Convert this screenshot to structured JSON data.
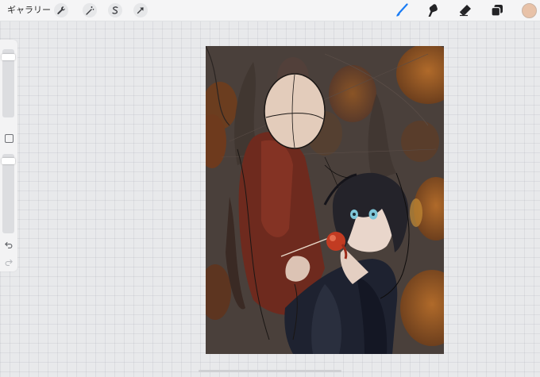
{
  "toolbar": {
    "gallery_label": "ギャラリー",
    "left_tools": [
      {
        "name": "actions",
        "icon": "wrench-icon"
      },
      {
        "name": "adjustments",
        "icon": "magic-wand-icon"
      },
      {
        "name": "selection",
        "icon": "selection-s-icon"
      },
      {
        "name": "transform",
        "icon": "arrow-cursor-icon"
      }
    ],
    "right_tools": [
      {
        "name": "brush",
        "icon": "brush-icon",
        "active": true
      },
      {
        "name": "smudge",
        "icon": "smudge-icon",
        "active": false
      },
      {
        "name": "eraser",
        "icon": "eraser-icon",
        "active": false
      },
      {
        "name": "layers",
        "icon": "layers-icon",
        "active": false
      }
    ],
    "current_color": "#e8c2a8",
    "accent_color": "#1a7cf5"
  },
  "sidebar": {
    "brush_size_icon": "slider-icon",
    "opacity_icon": "slider-icon",
    "modify_icon": "square-icon",
    "undo_icon": "undo-arrow-icon",
    "redo_icon": "redo-arrow-icon"
  },
  "canvas": {
    "background_color": "#4a403b",
    "content": "artwork"
  }
}
